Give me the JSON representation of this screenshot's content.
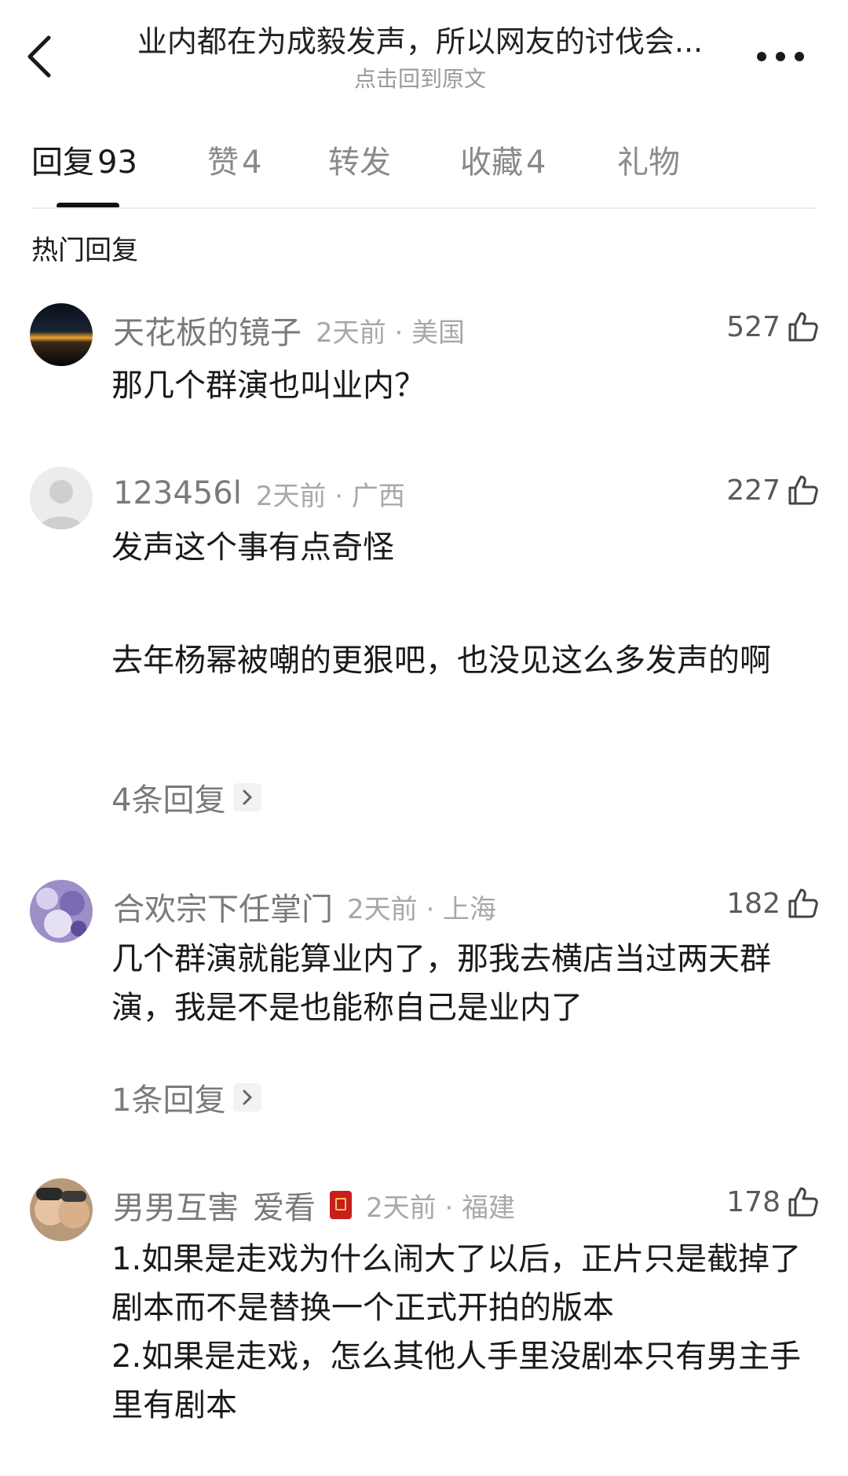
{
  "header": {
    "title": "业内都在为成毅发声，所以网友的讨伐会...",
    "subtitle": "点击回到原文"
  },
  "tabs": [
    {
      "label": "回复",
      "count": "93"
    },
    {
      "label": "赞",
      "count": "4"
    },
    {
      "label": "转发",
      "count": ""
    },
    {
      "label": "收藏",
      "count": "4"
    },
    {
      "label": "礼物",
      "count": ""
    }
  ],
  "section_title": "热门回复",
  "comments": [
    {
      "username": "天花板的镜子",
      "meta": "2天前 · 美国",
      "likes": "527",
      "text": [
        "那几个群演也叫业内？"
      ]
    },
    {
      "username": "123456l",
      "meta": "2天前 · 广西",
      "likes": "227",
      "text": [
        "发声这个事有点奇怪",
        "去年杨幂被嘲的更狠吧，也没见这么多发声的啊"
      ],
      "replies": "4条回复"
    },
    {
      "username": "合欢宗下任掌门",
      "meta": "2天前 · 上海",
      "likes": "182",
      "text": [
        "几个群演就能算业内了，那我去横店当过两天群演，我是不是也能称自己是业内了"
      ],
      "replies": "1条回复"
    },
    {
      "username": "男男互害",
      "tag": "爱看",
      "meta": "2天前 · 福建",
      "likes": "178",
      "text": [
        "1.如果是走戏为什么闹大了以后，正片只是截掉了剧本而不是替换一个正式开拍的版本",
        "2.如果是走戏，怎么其他人手里没剧本只有男主手里有剧本"
      ]
    }
  ],
  "icons": {
    "back": "chevron-left-icon",
    "more": "more-dots-icon",
    "like": "thumbs-up-icon",
    "reply_arrow": "chevron-right-icon"
  }
}
